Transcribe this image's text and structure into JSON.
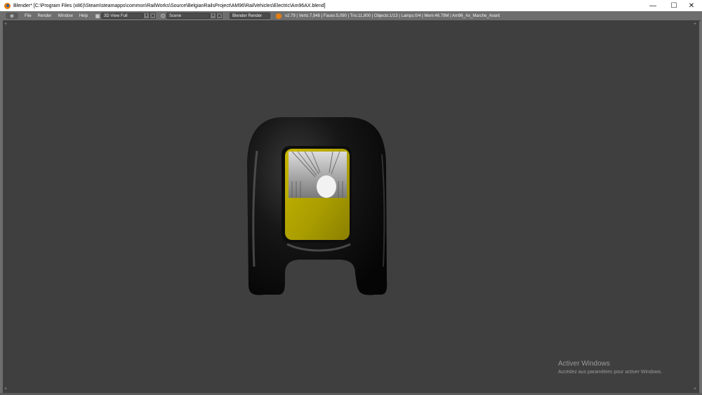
{
  "window": {
    "title": "Blender* [C:\\Program Files (x86)\\Steam\\steamapps\\common\\RailWorks\\Source\\BelgianRailsProject\\AM96\\RailVehicles\\Electric\\Am96AX.blend]",
    "minimize_glyph": "—",
    "maximize_glyph": "☐",
    "close_glyph": "✕"
  },
  "menubar": {
    "menus": [
      "File",
      "Render",
      "Window",
      "Help"
    ],
    "screen_layout": "3D View Full",
    "scene": "Scene",
    "render_engine": "Blender Render",
    "stats": "v2.79 | Verts:7,948 | Faces:5,090 | Tris:11,800 | Objects:1/13 | Lamps:0/4 | Mem:46.79M | Am96_Ax_Marche_Avant",
    "add_glyph": "+",
    "remove_glyph": "✕",
    "editor_glyph": "⊕",
    "layout_glyph": "▦",
    "scene_glyph": "⌬"
  },
  "watermark": {
    "title": "Activer Windows",
    "subtitle": "Accédez aux paramètres pour activer Windows."
  },
  "colors": {
    "viewport_bg": "#3f3f3f",
    "header_bg": "#6e6e6e",
    "model_body": "#141414",
    "window_yellow": "#a99d00"
  }
}
